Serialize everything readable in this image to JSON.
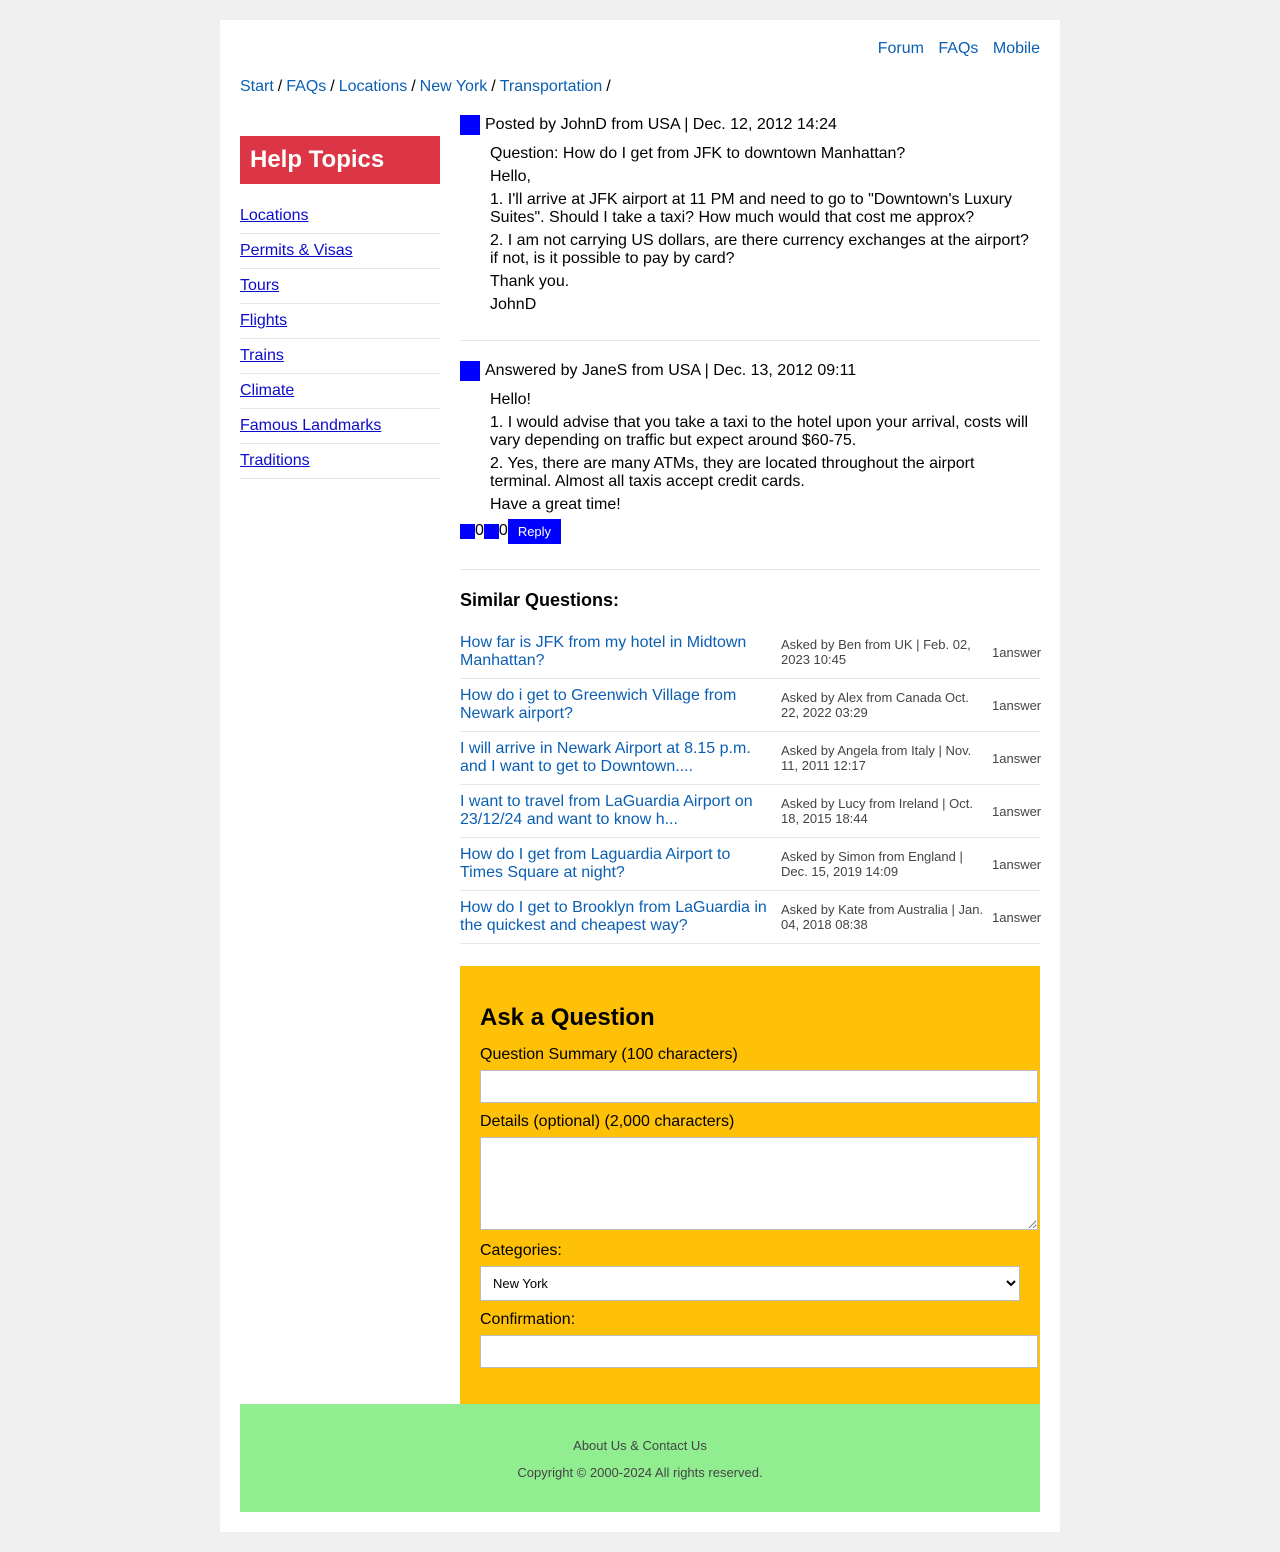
{
  "nav": {
    "forum": "Forum",
    "faqs": "FAQs",
    "mobile": "Mobile"
  },
  "breadcrumb": [
    "Start",
    "FAQs",
    "Locations",
    "New York",
    "Transportation"
  ],
  "breadcrumb_sep": "/",
  "sidebar": {
    "title": "Help Topics",
    "items": [
      "Locations",
      "Permits & Visas",
      "Tours",
      "Flights",
      "Trains",
      "Climate",
      "Famous Landmarks",
      "Traditions"
    ]
  },
  "question": {
    "header": "Posted by JohnD from USA | Dec. 12, 2012 14:24",
    "lines": [
      "Question: How do I get from JFK to downtown Manhattan?",
      "Hello,",
      "1. I'll arrive at JFK airport at 11 PM and need to go to \"Downtown's Luxury Suites\". Should I take a taxi? How much would that cost me approx?",
      "2. I am not carrying US dollars, are there currency exchanges at the airport? if not, is it possible to pay by card?",
      "Thank you.",
      "JohnD"
    ]
  },
  "answer": {
    "header": "Answered by JaneS from USA | Dec. 13, 2012 09:11",
    "lines": [
      "Hello!",
      "1. I would advise that you take a taxi to the hotel upon your arrival, costs will vary depending on traffic but expect around $60-75.",
      "2. Yes, there are many ATMs, they are located throughout the airport terminal. Almost all taxis accept credit cards.",
      "Have a great time!"
    ],
    "upvotes": "0",
    "downvotes": "0",
    "reply_label": "Reply"
  },
  "similar": {
    "title": "Similar Questions:",
    "items": [
      {
        "q": "How far is JFK from my hotel in Midtown Manhattan?",
        "meta": "Asked by Ben from UK | Feb. 02, 2023 10:45",
        "answers": "1answer"
      },
      {
        "q": "How do i get to Greenwich Village from Newark airport?",
        "meta": "Asked by Alex from Canada Oct. 22, 2022 03:29",
        "answers": "1answer"
      },
      {
        "q": "I will arrive in Newark Airport at 8.15 p.m. and I want to get to Downtown....",
        "meta": "Asked by Angela from Italy | Nov. 11, 2011 12:17",
        "answers": "1answer"
      },
      {
        "q": "I want to travel from LaGuardia Airport on 23/12/24 and want to know h...",
        "meta": "Asked by Lucy from Ireland | Oct. 18, 2015 18:44",
        "answers": "1answer"
      },
      {
        "q": "How do I get from Laguardia Airport to Times Square at night?",
        "meta": "Asked by Simon from England | Dec. 15, 2019 14:09",
        "answers": "1answer"
      },
      {
        "q": "How do I get to Brooklyn from LaGuardia in the quickest and cheapest way?",
        "meta": "Asked by Kate from Australia | Jan. 04, 2018 08:38",
        "answers": "1answer"
      }
    ]
  },
  "ask": {
    "title": "Ask a Question",
    "summary_label": "Question Summary (100 characters)",
    "summary_value": "",
    "details_label": "Details (optional) (2,000 characters)",
    "details_value": "",
    "categories_label": "Categories:",
    "category_selected": "New York",
    "confirmation_label": "Confirmation:",
    "confirmation_value": ""
  },
  "footer": {
    "links": "About Us & Contact Us",
    "copyright": "Copyright © 2000-2024 All rights reserved."
  },
  "colors": {
    "link": "#0b5fb3",
    "sidebar_header": "#dc3545",
    "ask_bg": "#ffc107",
    "footer_bg": "#90ee90",
    "icon_blue": "#0000ff"
  }
}
